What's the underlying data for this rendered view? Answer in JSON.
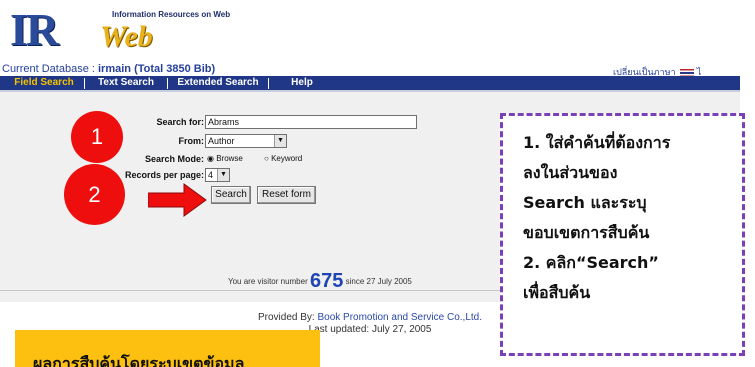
{
  "logo": {
    "ir": "IR",
    "web": "Web",
    "tagline": "Information Resources on Web"
  },
  "header": {
    "current_db_label": "Current Database :",
    "db_name": "irmain (Total 3850 Bib)",
    "language_switch": "เปลี่ยนเป็นภาษา",
    "language_trailing": "ไ"
  },
  "nav": {
    "tabs": [
      "Field Search",
      "Text Search",
      "Extended Search",
      "Help"
    ],
    "active": "Field Search"
  },
  "form": {
    "search_for_label": "Search for:",
    "search_for_value": "Abrams",
    "from_label": "From:",
    "from_value": "Author",
    "mode_label": "Search Mode:",
    "mode_browse": "Browse",
    "mode_keyword": "Keyword",
    "records_label": "Records per page:",
    "records_value": "4",
    "search_button": "Search",
    "reset_button": "Reset form"
  },
  "visitor": {
    "prefix": "You are visitor number",
    "count": "675",
    "suffix": "since 27 July 2005"
  },
  "footer": {
    "provided_by_label": "Provided By:",
    "provider": "Book Promotion and Service Co.,Ltd.",
    "last_updated": "Last updated: July 27, 2005"
  },
  "annotations": {
    "step1": "1",
    "step2": "2",
    "callout_lines": [
      "1. ใส่คำค้นที่ต้องการ",
      "ลงในส่วนของ",
      "Search และระบุ",
      "ขอบเขตการสืบค้น",
      "2. คลิก“Search”",
      "เพื่อสืบค้น"
    ],
    "orange_label": "ผลการสืบค้นโดยระบุเขตข้อมูล"
  },
  "colors": {
    "nav_bg": "#1f3786",
    "active_tab": "#f5c400",
    "marker_red": "#ee0e0e",
    "callout_border": "#7b3fb8",
    "orange_box": "#fdc010",
    "visitor_count": "#1f45b3"
  }
}
